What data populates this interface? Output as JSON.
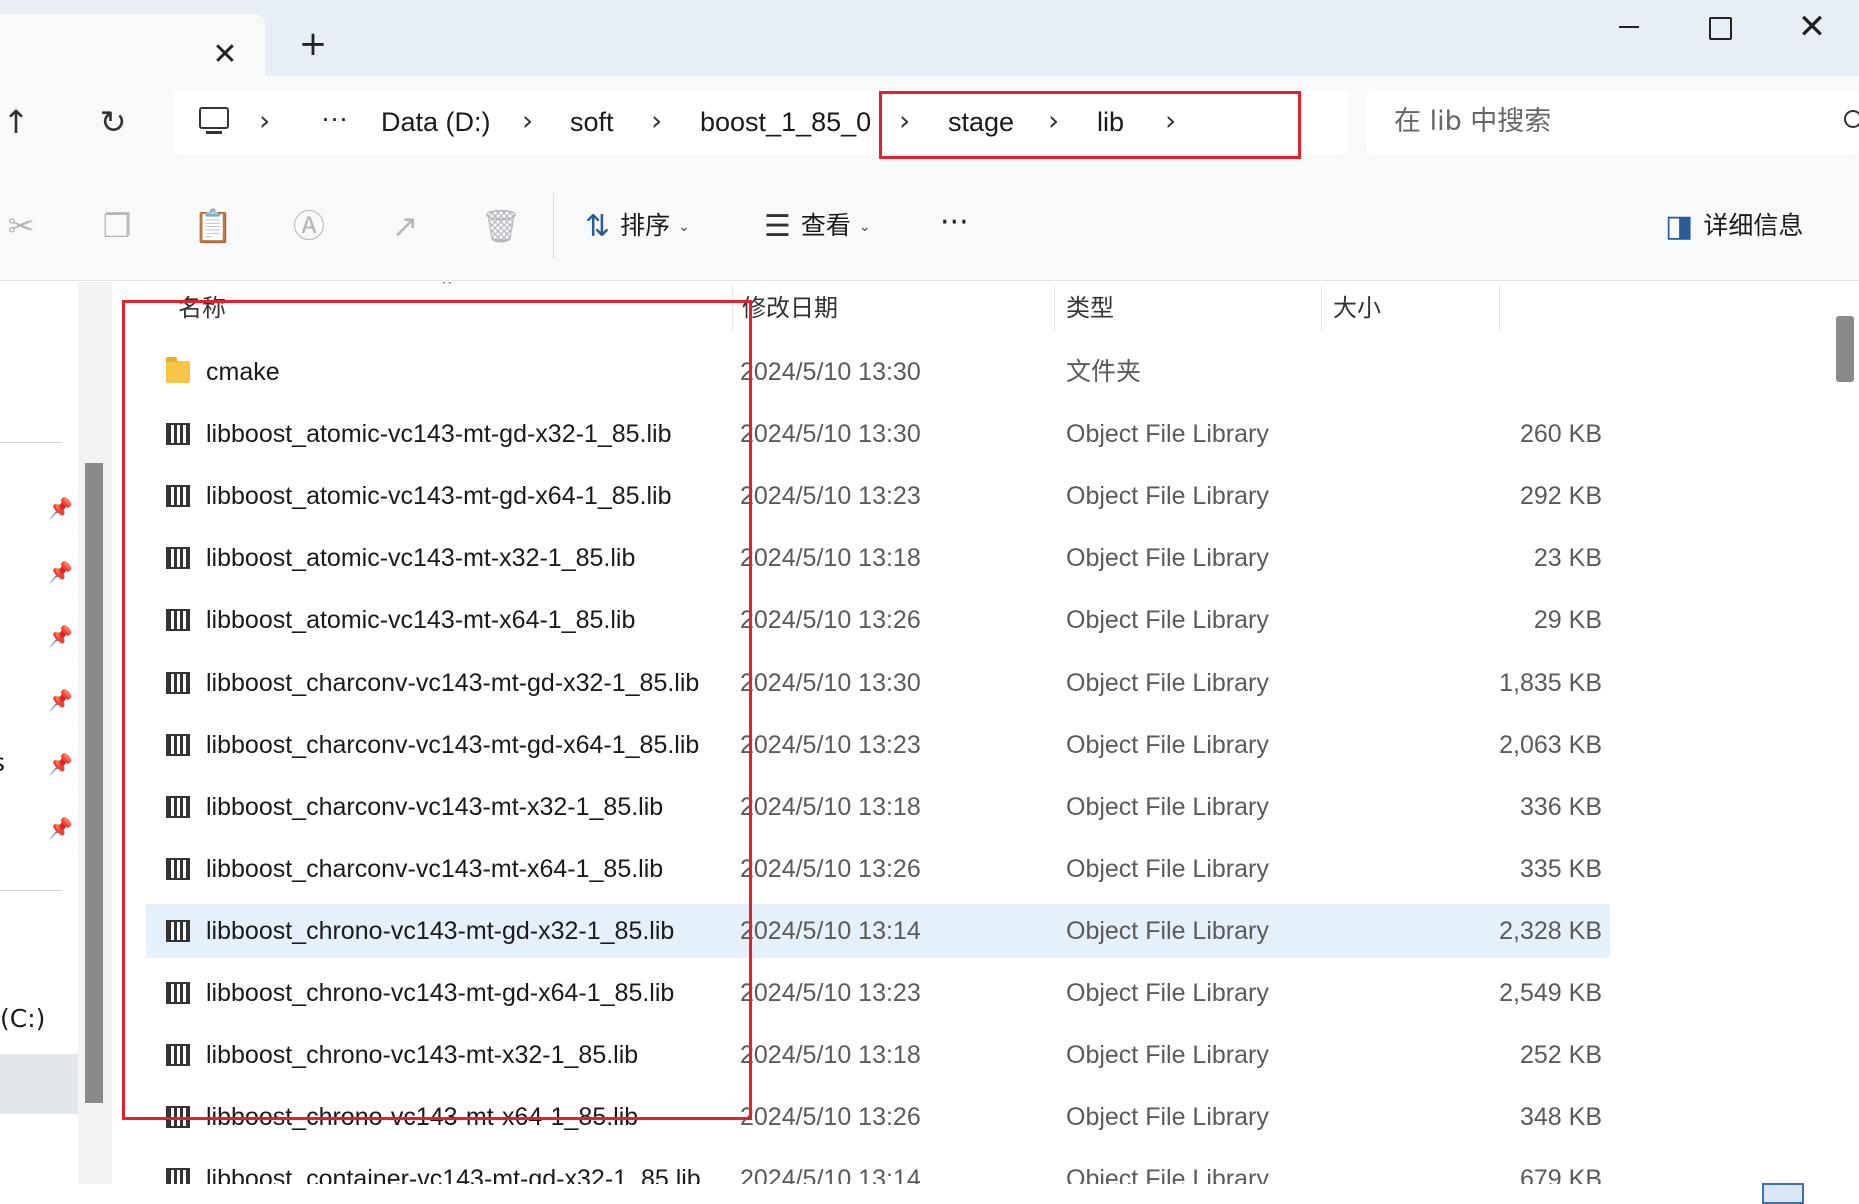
{
  "titlebar": {
    "new_tab": "+",
    "tab_close": "✕",
    "minimize": "",
    "maximize": "",
    "close": "✕"
  },
  "nav": {
    "up": "↑",
    "refresh": "↻",
    "breadcrumb": [
      "Data (D:)",
      "soft",
      "boost_1_85_0",
      "stage",
      "lib"
    ],
    "more": "···",
    "chevron": "›",
    "search_placeholder": "在 lib 中搜索"
  },
  "toolbar": {
    "sort_label": "排序",
    "view_label": "查看",
    "more": "···",
    "details_label": "详细信息"
  },
  "columns": {
    "name": "名称",
    "date": "修改日期",
    "type": "类型",
    "size": "大小"
  },
  "leftpane": {
    "drive_c": "(C:)",
    "partial_s": "s"
  },
  "files": [
    {
      "name": "cmake",
      "date": "2024/5/10 13:30",
      "type": "文件夹",
      "size": "",
      "kind": "folder"
    },
    {
      "name": "libboost_atomic-vc143-mt-gd-x32-1_85.lib",
      "date": "2024/5/10 13:30",
      "type": "Object File Library",
      "size": "260 KB",
      "kind": "lib"
    },
    {
      "name": "libboost_atomic-vc143-mt-gd-x64-1_85.lib",
      "date": "2024/5/10 13:23",
      "type": "Object File Library",
      "size": "292 KB",
      "kind": "lib"
    },
    {
      "name": "libboost_atomic-vc143-mt-x32-1_85.lib",
      "date": "2024/5/10 13:18",
      "type": "Object File Library",
      "size": "23 KB",
      "kind": "lib"
    },
    {
      "name": "libboost_atomic-vc143-mt-x64-1_85.lib",
      "date": "2024/5/10 13:26",
      "type": "Object File Library",
      "size": "29 KB",
      "kind": "lib"
    },
    {
      "name": "libboost_charconv-vc143-mt-gd-x32-1_85.lib",
      "date": "2024/5/10 13:30",
      "type": "Object File Library",
      "size": "1,835 KB",
      "kind": "lib"
    },
    {
      "name": "libboost_charconv-vc143-mt-gd-x64-1_85.lib",
      "date": "2024/5/10 13:23",
      "type": "Object File Library",
      "size": "2,063 KB",
      "kind": "lib"
    },
    {
      "name": "libboost_charconv-vc143-mt-x32-1_85.lib",
      "date": "2024/5/10 13:18",
      "type": "Object File Library",
      "size": "336 KB",
      "kind": "lib"
    },
    {
      "name": "libboost_charconv-vc143-mt-x64-1_85.lib",
      "date": "2024/5/10 13:26",
      "type": "Object File Library",
      "size": "335 KB",
      "kind": "lib"
    },
    {
      "name": "libboost_chrono-vc143-mt-gd-x32-1_85.lib",
      "date": "2024/5/10 13:14",
      "type": "Object File Library",
      "size": "2,328 KB",
      "kind": "lib",
      "selected": true
    },
    {
      "name": "libboost_chrono-vc143-mt-gd-x64-1_85.lib",
      "date": "2024/5/10 13:23",
      "type": "Object File Library",
      "size": "2,549 KB",
      "kind": "lib"
    },
    {
      "name": "libboost_chrono-vc143-mt-x32-1_85.lib",
      "date": "2024/5/10 13:18",
      "type": "Object File Library",
      "size": "252 KB",
      "kind": "lib"
    },
    {
      "name": "libboost_chrono-vc143-mt-x64-1_85.lib",
      "date": "2024/5/10 13:26",
      "type": "Object File Library",
      "size": "348 KB",
      "kind": "lib"
    },
    {
      "name": "libboost_container-vc143-mt-gd-x32-1_85.lib",
      "date": "2024/5/10 13:14",
      "type": "Object File Library",
      "size": "679 KB",
      "kind": "lib"
    }
  ],
  "colors": {
    "highlight_box": "#e3202b",
    "selected_row": "#e5f0fb",
    "titlebar": "#e7eef6"
  }
}
